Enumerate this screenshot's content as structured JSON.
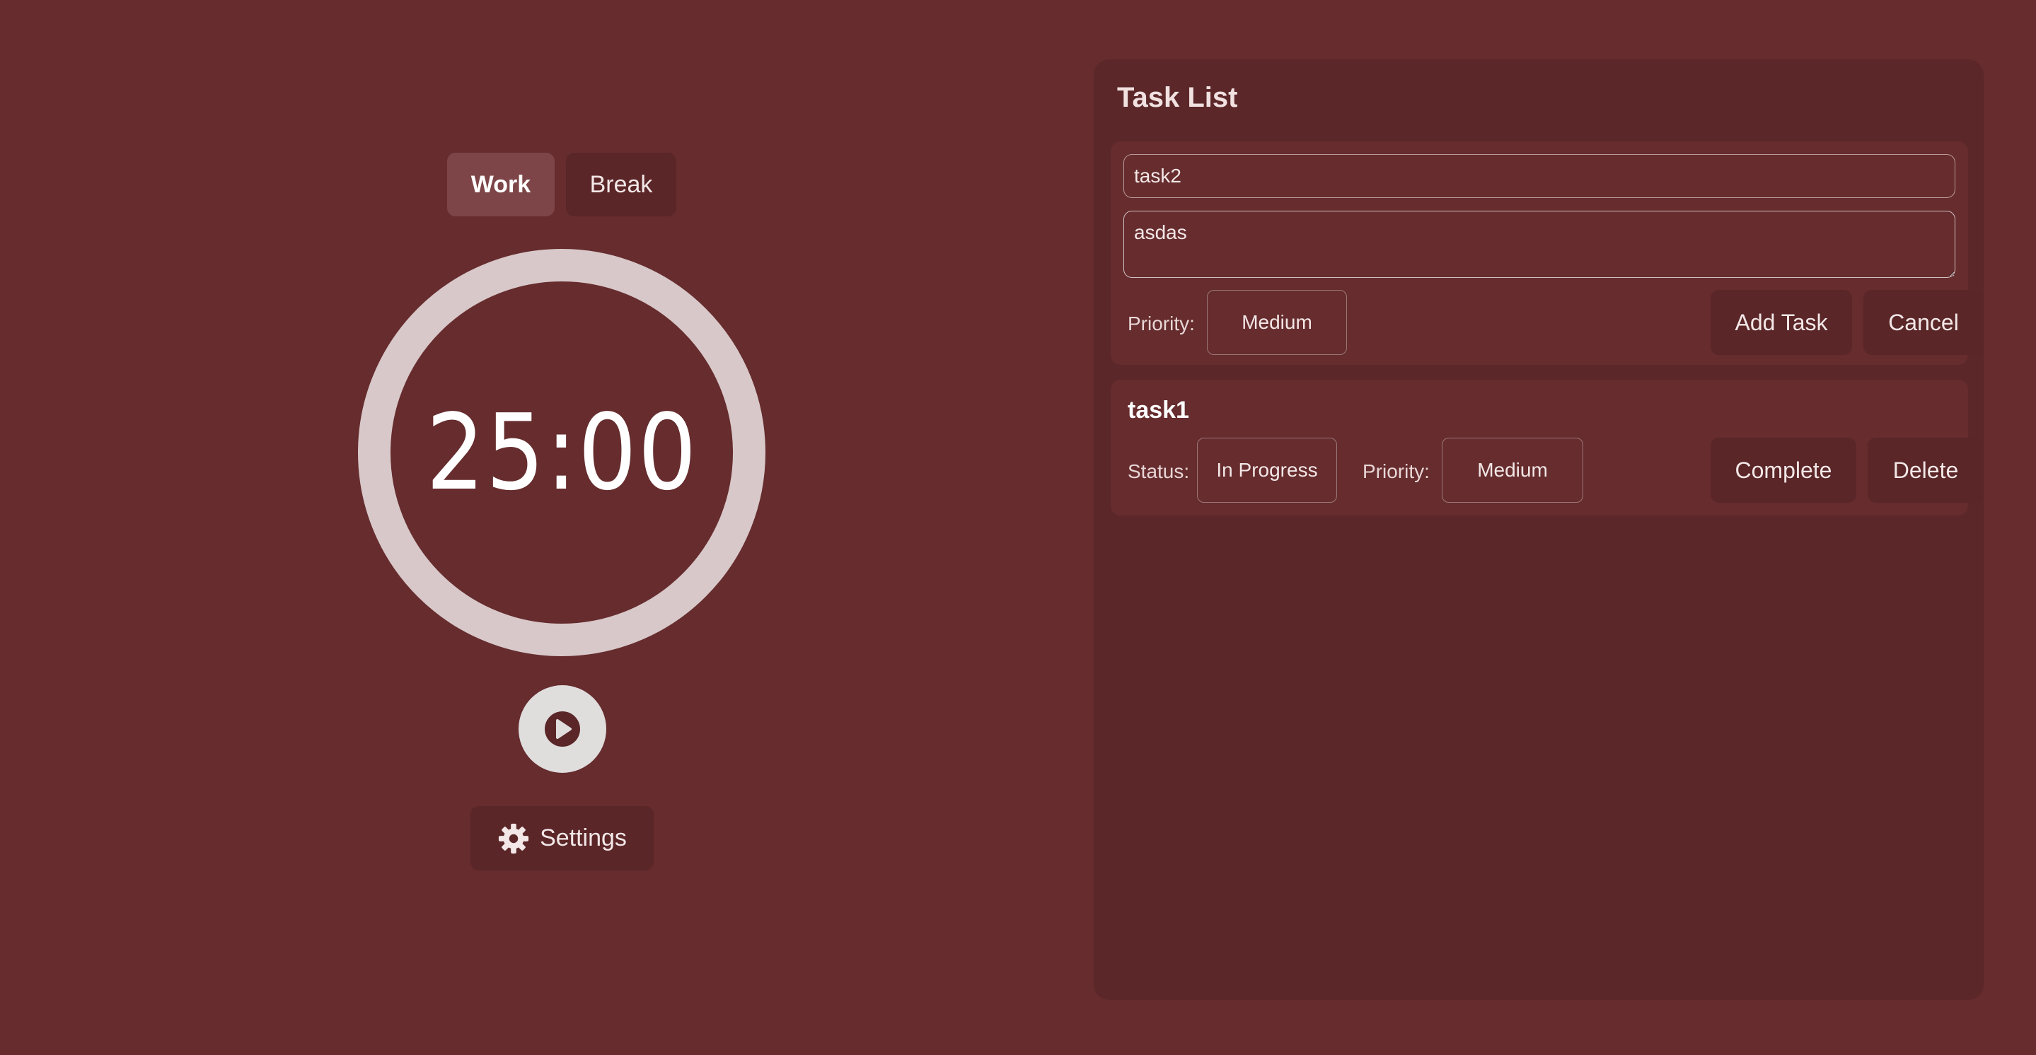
{
  "timer": {
    "modes": {
      "work_label": "Work",
      "break_label": "Break",
      "active": "work"
    },
    "time_display": "25:00",
    "play_icon": "play-icon",
    "settings_label": "Settings",
    "settings_icon": "gear-icon"
  },
  "task_panel": {
    "title": "Task List",
    "new_task_form": {
      "title_value": "task2",
      "description_value": "asdas",
      "priority_label": "Priority:",
      "priority_value": "Medium",
      "add_label": "Add Task",
      "cancel_label": "Cancel"
    },
    "tasks": [
      {
        "name": "task1",
        "status_label": "Status:",
        "status_value": "In Progress",
        "priority_label": "Priority:",
        "priority_value": "Medium",
        "complete_label": "Complete",
        "delete_label": "Delete"
      }
    ]
  },
  "colors": {
    "background": "#662c2e",
    "panel": "#5b2729",
    "button": "#5a2628",
    "active_tab": "#7d4547",
    "timer_ring": "#d8c8c9"
  }
}
